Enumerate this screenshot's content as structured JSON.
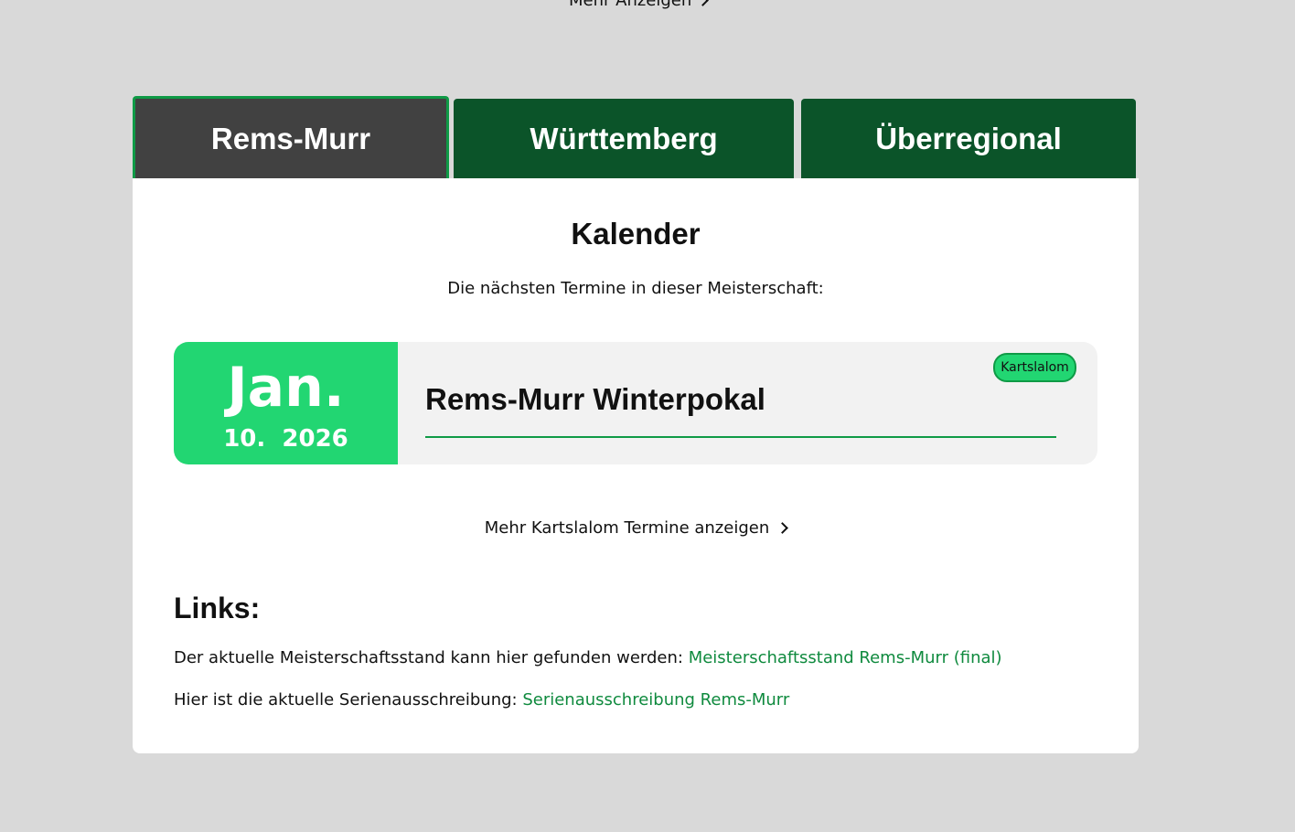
{
  "top_more_link": "Mehr Anzeigen",
  "tabs": [
    {
      "label": "Rems-Murr",
      "active": true
    },
    {
      "label": "Württemberg",
      "active": false
    },
    {
      "label": "Überregional",
      "active": false
    }
  ],
  "calendar": {
    "title": "Kalender",
    "subtitle": "Die nächsten Termine in dieser Meisterschaft:",
    "event": {
      "month": "Jan.",
      "day": "10.",
      "year": "2026",
      "title": "Rems-Murr Winterpokal",
      "badge": "Kartslalom"
    },
    "more_link": "Mehr Kartslalom Termine anzeigen"
  },
  "links": {
    "title": "Links:",
    "items": [
      {
        "text": "Der aktuelle Meisterschaftsstand kann hier gefunden werden: ",
        "link": "Meisterschaftsstand Rems-Murr (final)"
      },
      {
        "text": "Hier ist die aktuelle Serienausschreibung: ",
        "link": "Serienausschreibung Rems-Murr"
      }
    ]
  },
  "colors": {
    "tab_inactive": "#0b5429",
    "tab_active": "#414141",
    "accent_green": "#22d672",
    "link_green": "#0f8a3e"
  }
}
